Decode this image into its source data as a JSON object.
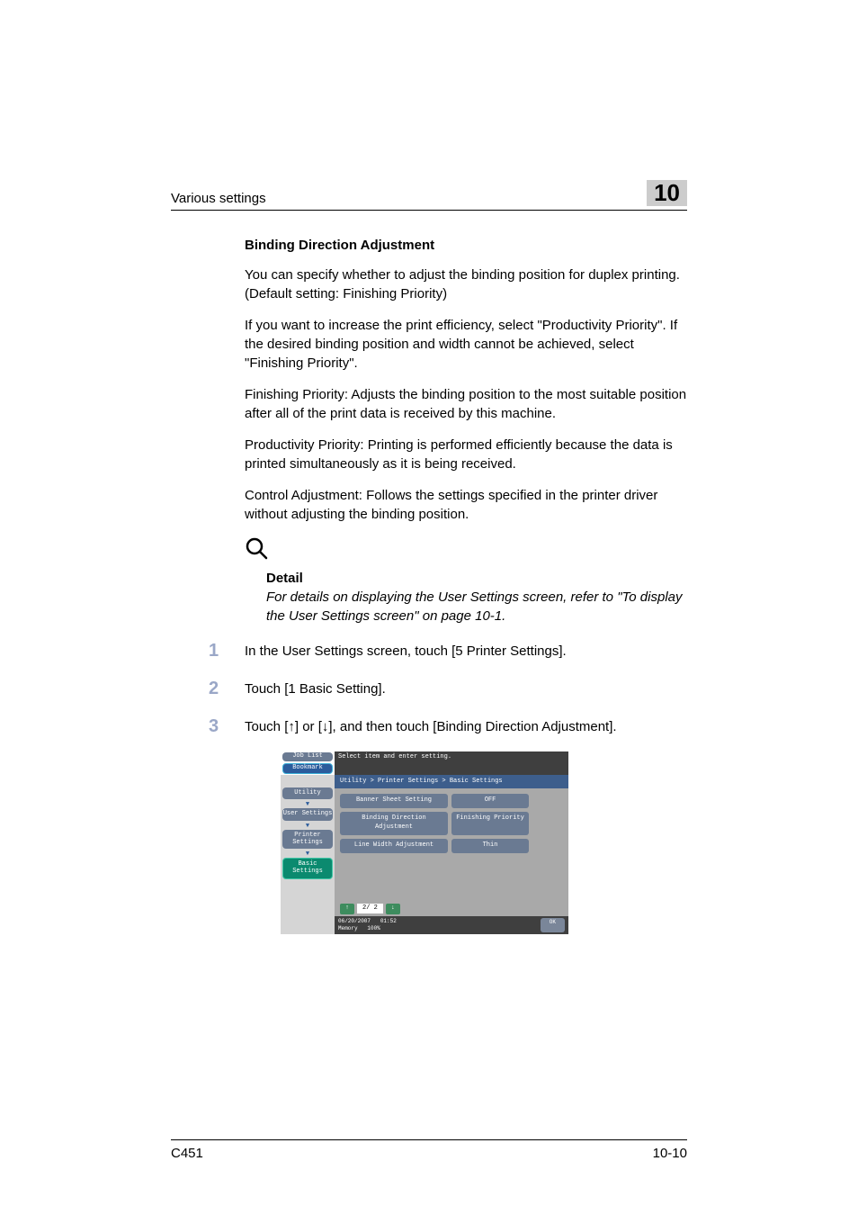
{
  "header": {
    "section": "Various settings",
    "chapter": "10"
  },
  "body": {
    "heading": "Binding Direction Adjustment",
    "p1": "You can specify whether to adjust the binding position for duplex printing. (Default setting: Finishing Priority)",
    "p2": "If you want to increase the print efficiency, select \"Productivity Priority\". If the desired binding position and width cannot be achieved, select \"Finishing Priority\".",
    "p3": "Finishing Priority: Adjusts the binding position to the most suitable position after all of the print data is received by this machine.",
    "p4": "Productivity Priority: Printing is performed efficiently because the data is printed simultaneously as it is being received.",
    "p5": "Control Adjustment: Follows the settings specified in the printer driver without adjusting the binding position.",
    "detail_label": "Detail",
    "detail_text": "For details on displaying the User Settings screen, refer to \"To display the User Settings screen\" on page 10-1."
  },
  "steps": {
    "n1": "1",
    "s1": "In the User Settings screen, touch [5 Printer Settings].",
    "n2": "2",
    "s2": "Touch [1 Basic Setting].",
    "n3": "3",
    "s3": "Touch [↑] or [↓], and then touch [Binding Direction Adjustment]."
  },
  "shot": {
    "job_list": "Job List",
    "bookmark": "Bookmark",
    "instruction": "Select item and enter setting.",
    "breadcrumb": "Utility > Printer Settings > Basic Settings",
    "side": {
      "utility": "Utility",
      "user": "User Settings",
      "printer": "Printer Settings",
      "basic": "Basic Settings"
    },
    "rows": {
      "r1l": "Banner Sheet Setting",
      "r1v": "OFF",
      "r2l": "Binding Direction Adjustment",
      "r2v": "Finishing Priority",
      "r3l": "Line Width Adjustment",
      "r3v": "Thin"
    },
    "pager": "2/ 2",
    "status": {
      "date": "06/20/2007",
      "time": "01:52",
      "mem_label": "Memory",
      "mem_val": "100%"
    },
    "ok": "OK"
  },
  "footer": {
    "left": "C451",
    "right": "10-10"
  }
}
